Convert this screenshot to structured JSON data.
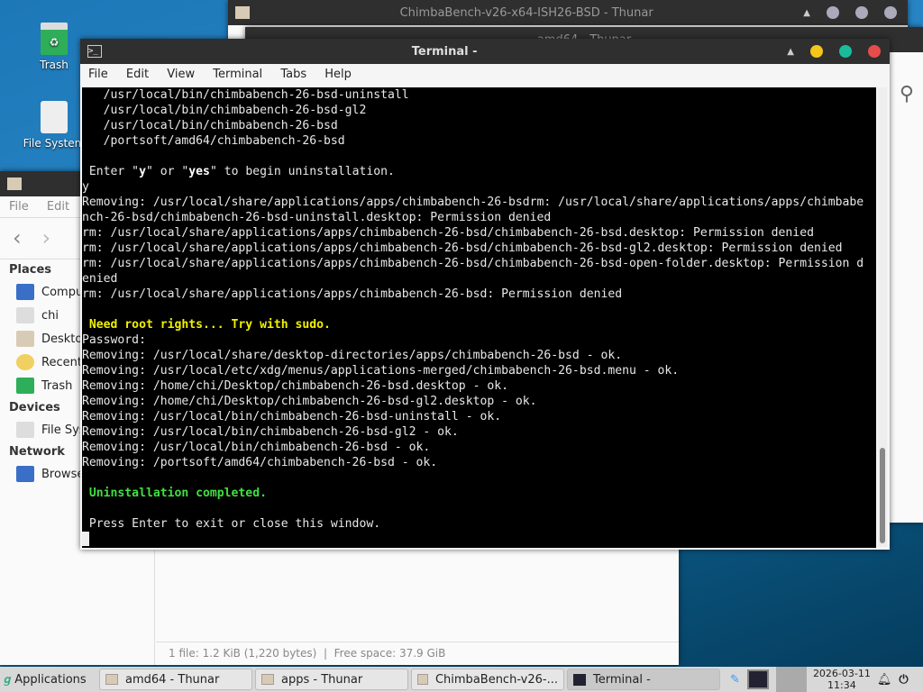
{
  "desktop": {
    "icons": [
      {
        "label": "Trash"
      },
      {
        "label": "File System"
      }
    ]
  },
  "back_window": {
    "title": "ChimbaBench-v26-x64-ISH26-BSD - Thunar"
  },
  "mid_window": {
    "title": "amd64 - Thunar"
  },
  "thunar": {
    "menu": [
      "File",
      "Edit"
    ],
    "places_header": "Places",
    "places": [
      "Computer",
      "chi",
      "Desktop",
      "Recent",
      "Trash"
    ],
    "devices_header": "Devices",
    "devices": [
      "File System"
    ],
    "network_header": "Network",
    "network": [
      "Browse Network"
    ],
    "status": "1 file: 1.2 KiB (1,220 bytes)  |  Free space: 37.9 GiB"
  },
  "terminal": {
    "title": "Terminal -",
    "menu": [
      "File",
      "Edit",
      "View",
      "Terminal",
      "Tabs",
      "Help"
    ],
    "lines": [
      [
        {
          "t": "   /usr/local/bin/chimbabench-26-bsd-uninstall"
        }
      ],
      [
        {
          "t": "   /usr/local/bin/chimbabench-26-bsd-gl2"
        }
      ],
      [
        {
          "t": "   /usr/local/bin/chimbabench-26-bsd"
        }
      ],
      [
        {
          "t": "   /portsoft/amd64/chimbabench-26-bsd"
        }
      ],
      [
        {
          "t": ""
        }
      ],
      [
        {
          "t": " Enter \""
        },
        {
          "t": "y",
          "s": "b"
        },
        {
          "t": "\" or \""
        },
        {
          "t": "yes",
          "s": "b"
        },
        {
          "t": "\" to begin uninstallation."
        }
      ],
      [
        {
          "t": "y"
        }
      ],
      [
        {
          "t": "Removing: /usr/local/share/applications/apps/chimbabench-26-bsdrm: /usr/local/share/applications/apps/chimbabe"
        }
      ],
      [
        {
          "t": "nch-26-bsd/chimbabench-26-bsd-uninstall.desktop: Permission denied"
        }
      ],
      [
        {
          "t": "rm: /usr/local/share/applications/apps/chimbabench-26-bsd/chimbabench-26-bsd.desktop: Permission denied"
        }
      ],
      [
        {
          "t": "rm: /usr/local/share/applications/apps/chimbabench-26-bsd/chimbabench-26-bsd-gl2.desktop: Permission denied"
        }
      ],
      [
        {
          "t": "rm: /usr/local/share/applications/apps/chimbabench-26-bsd/chimbabench-26-bsd-open-folder.desktop: Permission d"
        }
      ],
      [
        {
          "t": "enied"
        }
      ],
      [
        {
          "t": "rm: /usr/local/share/applications/apps/chimbabench-26-bsd: Permission denied"
        }
      ],
      [
        {
          "t": ""
        }
      ],
      [
        {
          "t": " Need root rights... Try with sudo.",
          "s": "yl"
        }
      ],
      [
        {
          "t": "Password:"
        }
      ],
      [
        {
          "t": "Removing: /usr/local/share/desktop-directories/apps/chimbabench-26-bsd - ok."
        }
      ],
      [
        {
          "t": "Removing: /usr/local/etc/xdg/menus/applications-merged/chimbabench-26-bsd.menu - ok."
        }
      ],
      [
        {
          "t": "Removing: /home/chi/Desktop/chimbabench-26-bsd.desktop - ok."
        }
      ],
      [
        {
          "t": "Removing: /home/chi/Desktop/chimbabench-26-bsd-gl2.desktop - ok."
        }
      ],
      [
        {
          "t": "Removing: /usr/local/bin/chimbabench-26-bsd-uninstall - ok."
        }
      ],
      [
        {
          "t": "Removing: /usr/local/bin/chimbabench-26-bsd-gl2 - ok."
        }
      ],
      [
        {
          "t": "Removing: /usr/local/bin/chimbabench-26-bsd - ok."
        }
      ],
      [
        {
          "t": "Removing: /portsoft/amd64/chimbabench-26-bsd - ok."
        }
      ],
      [
        {
          "t": ""
        }
      ],
      [
        {
          "t": " Uninstallation completed.",
          "s": "gr"
        }
      ],
      [
        {
          "t": ""
        }
      ],
      [
        {
          "t": " Press Enter to exit or close this window."
        }
      ]
    ]
  },
  "taskbar": {
    "apps_label": "Applications",
    "tasks": [
      "amd64 - Thunar",
      "apps - Thunar",
      "ChimbaBench-v26-...",
      "Terminal -"
    ],
    "date": "2026-03-11",
    "time": "11:34"
  },
  "colors": {
    "min": "#f5c518",
    "max": "#1abc9c",
    "close": "#e74c4c"
  }
}
